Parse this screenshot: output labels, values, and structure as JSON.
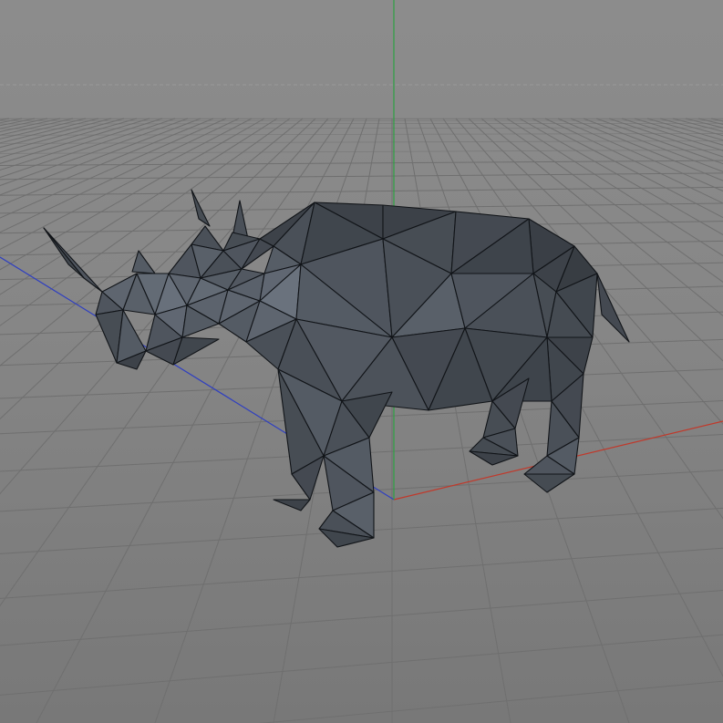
{
  "viewport": {
    "background_color": "#8a8a8a",
    "grid_color": "#6f6f6f",
    "horizon_line_style": "dashed",
    "projection": "perspective"
  },
  "axes": {
    "x_axis_color": "#c0392b",
    "y_axis_color": "#2ea043",
    "z_axis_color": "#2f3fc0"
  },
  "model": {
    "name_icon": "rhino-mesh-icon",
    "style": "low-poly",
    "base_color": "#4a5058",
    "highlight_color": "#7c8592",
    "shadow_color": "#2a2e33",
    "edge_color": "#111418"
  }
}
